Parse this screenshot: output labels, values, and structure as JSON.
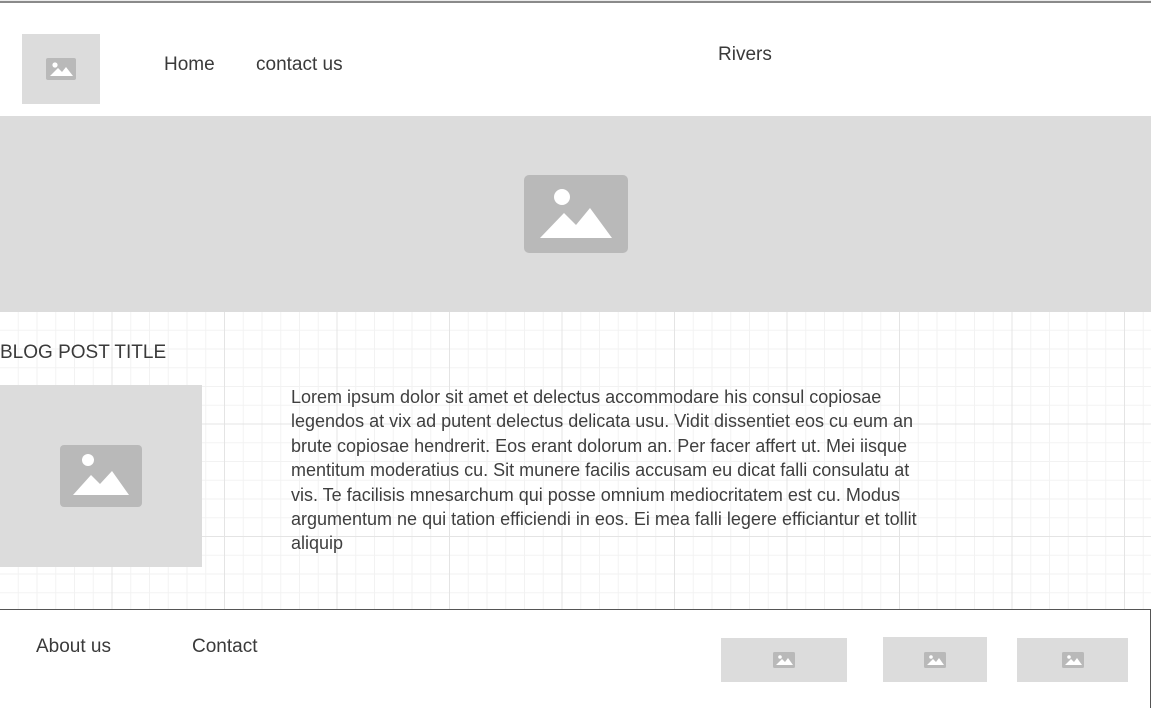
{
  "header": {
    "logo_icon": "image-placeholder-icon",
    "nav": [
      {
        "label": "Home"
      },
      {
        "label": "contact us"
      }
    ],
    "site_title": "Rivers"
  },
  "hero": {
    "icon": "image-placeholder-icon"
  },
  "post": {
    "title": "BLOG POST TITLE",
    "image_icon": "image-placeholder-icon",
    "body": "Lorem ipsum dolor sit amet et delectus accommodare his consul copiosae legendos at vix ad putent delectus delicata usu. Vidit dissentiet eos cu eum an brute copiosae hendrerit. Eos erant dolorum an. Per facer affert ut. Mei iisque mentitum moderatius cu. Sit munere facilis accusam eu dicat falli consulatu at vis. Te facilisis mnesarchum qui posse omnium mediocritatem est cu. Modus argumentum ne qui tation efficiendi in eos. Ei mea falli legere efficiantur et tollit aliquip"
  },
  "footer": {
    "links": [
      {
        "label": "About us"
      },
      {
        "label": "Contact"
      }
    ],
    "images": [
      "image-placeholder-icon",
      "image-placeholder-icon",
      "image-placeholder-icon"
    ]
  },
  "colors": {
    "placeholder_bg": "#dcdcdc",
    "placeholder_icon": "#b9b9b9",
    "text": "#3a3a3a",
    "grid": "#e4e4e4"
  }
}
